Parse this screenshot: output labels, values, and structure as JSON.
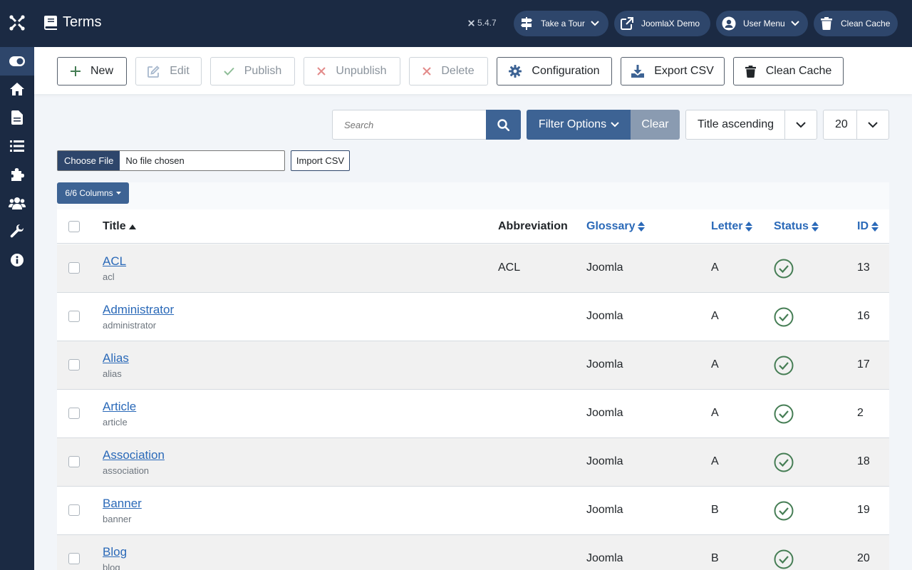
{
  "header": {
    "title": "Terms",
    "version": "5.4.7",
    "buttons": [
      {
        "label": "Take a Tour",
        "icon": "signpost-icon"
      },
      {
        "label": "JoomlaX Demo",
        "icon": "external-link-icon"
      },
      {
        "label": "User Menu",
        "icon": "user-circle-icon"
      },
      {
        "label": "Clean Cache",
        "icon": "trash-icon"
      }
    ]
  },
  "sidebar": {
    "items": [
      {
        "name": "toggle-menu",
        "icon": "toggle-icon"
      },
      {
        "name": "home",
        "icon": "home-icon"
      },
      {
        "name": "content",
        "icon": "file-icon"
      },
      {
        "name": "menus",
        "icon": "list-icon"
      },
      {
        "name": "components",
        "icon": "puzzle-icon"
      },
      {
        "name": "users",
        "icon": "users-icon"
      },
      {
        "name": "system",
        "icon": "wrench-icon"
      },
      {
        "name": "help",
        "icon": "info-icon"
      }
    ]
  },
  "toolbar": {
    "new_label": "New",
    "edit_label": "Edit",
    "publish_label": "Publish",
    "unpublish_label": "Unpublish",
    "delete_label": "Delete",
    "configuration_label": "Configuration",
    "export_label": "Export CSV",
    "clean_cache_label": "Clean Cache"
  },
  "filters": {
    "search_placeholder": "Search",
    "filter_options_label": "Filter Options",
    "clear_label": "Clear",
    "ordering_selected": "Title ascending",
    "limit_selected": "20"
  },
  "import": {
    "choose_file_label": "Choose File",
    "no_file_text": "No file chosen",
    "import_label": "Import CSV"
  },
  "table": {
    "columns_button": "6/6 Columns",
    "headers": {
      "title": "Title",
      "abbreviation": "Abbreviation",
      "glossary": "Glossary",
      "letter": "Letter",
      "status": "Status",
      "id": "ID"
    },
    "rows": [
      {
        "title": "ACL",
        "alias": "acl",
        "abbreviation": "ACL",
        "glossary": "Joomla",
        "letter": "A",
        "status": "published",
        "id": "13"
      },
      {
        "title": "Administrator",
        "alias": "administrator",
        "abbreviation": "",
        "glossary": "Joomla",
        "letter": "A",
        "status": "published",
        "id": "16"
      },
      {
        "title": "Alias",
        "alias": "alias",
        "abbreviation": "",
        "glossary": "Joomla",
        "letter": "A",
        "status": "published",
        "id": "17"
      },
      {
        "title": "Article",
        "alias": "article",
        "abbreviation": "",
        "glossary": "Joomla",
        "letter": "A",
        "status": "published",
        "id": "2"
      },
      {
        "title": "Association",
        "alias": "association",
        "abbreviation": "",
        "glossary": "Joomla",
        "letter": "A",
        "status": "published",
        "id": "18"
      },
      {
        "title": "Banner",
        "alias": "banner",
        "abbreviation": "",
        "glossary": "Joomla",
        "letter": "B",
        "status": "published",
        "id": "19"
      },
      {
        "title": "Blog",
        "alias": "blog",
        "abbreviation": "",
        "glossary": "Joomla",
        "letter": "B",
        "status": "published",
        "id": "20"
      }
    ]
  },
  "colors": {
    "header_bg": "#1b2a43",
    "primary": "#3d6394",
    "link": "#2a69b8",
    "success": "#457d54",
    "danger": "#c52827"
  }
}
